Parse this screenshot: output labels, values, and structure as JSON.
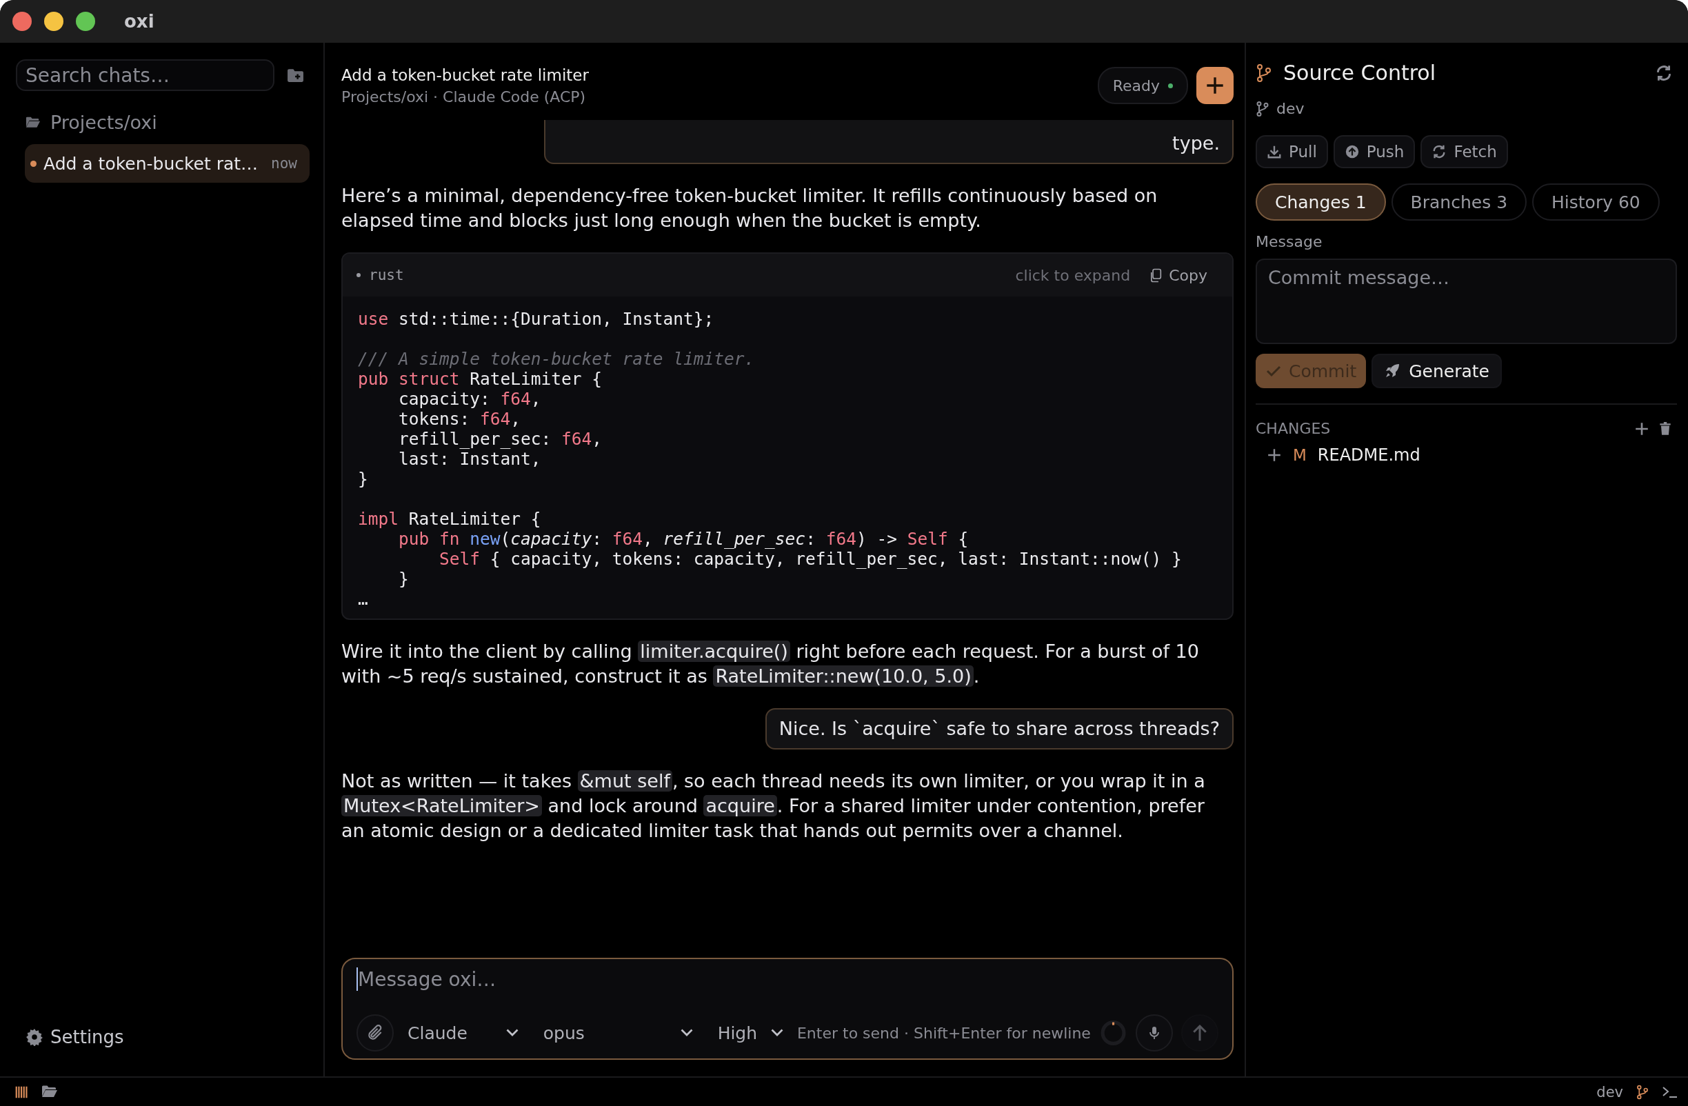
{
  "window": {
    "title": "oxi"
  },
  "sidebar": {
    "search": {
      "placeholder": "Search chats…"
    },
    "groups": [
      {
        "label": "Projects/oxi",
        "chats": [
          {
            "title": "Add a token-bucket rat…",
            "time": "now",
            "selected": true,
            "unread": true
          }
        ]
      }
    ],
    "settings": "Settings"
  },
  "chat": {
    "title": "Add a token-bucket rate limiter",
    "subtitle": "Projects/oxi · Claude Code (ACP)",
    "status": {
      "label": "Ready",
      "online": true
    },
    "messages": [
      {
        "kind": "user",
        "clipped": true,
        "text": "type."
      },
      {
        "kind": "text",
        "segments": [
          {
            "t": "Here’s a minimal, dependency-free token-bucket limiter. It refills continuously based on elapsed time and blocks just long enough when the bucket is empty.",
            "code": false
          }
        ]
      },
      {
        "kind": "code",
        "language": "rust",
        "expand_hint": "click to expand",
        "copy": "Copy",
        "lines": [
          {
            "kind": "code",
            "tokens": [
              {
                "t": "use",
                "kind": "keyword"
              },
              {
                "t": " std::time::{Duration, Instant};",
                "kind": "plain"
              }
            ]
          },
          {
            "kind": "blank"
          },
          {
            "kind": "code",
            "tokens": [
              {
                "t": "/// A simple token-bucket rate limiter.",
                "kind": "comment"
              }
            ]
          },
          {
            "kind": "code",
            "tokens": [
              {
                "t": "pub struct",
                "kind": "keyword"
              },
              {
                "t": " RateLimiter {",
                "kind": "plain"
              }
            ]
          },
          {
            "kind": "code",
            "tokens": [
              {
                "t": "    capacity: ",
                "kind": "plain"
              },
              {
                "t": "f64",
                "kind": "keyword"
              },
              {
                "t": ",",
                "kind": "plain"
              }
            ]
          },
          {
            "kind": "code",
            "tokens": [
              {
                "t": "    tokens: ",
                "kind": "plain"
              },
              {
                "t": "f64",
                "kind": "keyword"
              },
              {
                "t": ",",
                "kind": "plain"
              }
            ]
          },
          {
            "kind": "code",
            "tokens": [
              {
                "t": "    refill_per_sec: ",
                "kind": "plain"
              },
              {
                "t": "f64",
                "kind": "keyword"
              },
              {
                "t": ",",
                "kind": "plain"
              }
            ]
          },
          {
            "kind": "code",
            "tokens": [
              {
                "t": "    last: Instant,",
                "kind": "plain"
              }
            ]
          },
          {
            "kind": "code",
            "tokens": [
              {
                "t": "}",
                "kind": "plain"
              }
            ]
          },
          {
            "kind": "blank"
          },
          {
            "kind": "code",
            "tokens": [
              {
                "t": "impl",
                "kind": "keyword"
              },
              {
                "t": " RateLimiter {",
                "kind": "plain"
              }
            ]
          },
          {
            "kind": "code",
            "tokens": [
              {
                "t": "    pub fn",
                "kind": "keyword"
              },
              {
                "t": " new",
                "kind": "function"
              },
              {
                "t": "(",
                "kind": "plain"
              },
              {
                "t": "capacity",
                "kind": "parameter"
              },
              {
                "t": ": ",
                "kind": "plain"
              },
              {
                "t": "f64",
                "kind": "keyword"
              },
              {
                "t": ", ",
                "kind": "plain"
              },
              {
                "t": "refill_per_sec",
                "kind": "parameter"
              },
              {
                "t": ": ",
                "kind": "plain"
              },
              {
                "t": "f64",
                "kind": "keyword"
              },
              {
                "t": ") -> ",
                "kind": "plain"
              },
              {
                "t": "Self",
                "kind": "keyword"
              },
              {
                "t": " {",
                "kind": "plain"
              }
            ]
          },
          {
            "kind": "code",
            "tokens": [
              {
                "t": "        Self",
                "kind": "keyword"
              },
              {
                "t": " { capacity, tokens: capacity, refill_per_sec, last: Instant::now() }",
                "kind": "plain"
              }
            ]
          },
          {
            "kind": "code",
            "tokens": [
              {
                "t": "    }",
                "kind": "plain"
              }
            ]
          },
          {
            "kind": "code",
            "tokens": [
              {
                "t": "…",
                "kind": "plain"
              }
            ]
          }
        ]
      },
      {
        "kind": "text",
        "segments": [
          {
            "t": "Wire it into the client by calling ",
            "code": false
          },
          {
            "t": "limiter.acquire()",
            "code": true
          },
          {
            "t": " right before each request. For a burst of 10 with ~5 req/s sustained, construct it as ",
            "code": false
          },
          {
            "t": "RateLimiter::new(10.0, 5.0)",
            "code": true
          },
          {
            "t": ".",
            "code": false
          }
        ]
      },
      {
        "kind": "user",
        "clipped": false,
        "text": "Nice. Is `acquire` safe to share across threads?"
      },
      {
        "kind": "text",
        "segments": [
          {
            "t": "Not as written — it takes ",
            "code": false
          },
          {
            "t": "&mut self",
            "code": true
          },
          {
            "t": ", so each thread needs its own limiter, or you wrap it in a ",
            "code": false
          },
          {
            "t": "Mutex<RateLimiter>",
            "code": true
          },
          {
            "t": " and lock around ",
            "code": false
          },
          {
            "t": "acquire",
            "code": true
          },
          {
            "t": ". For a shared limiter under contention, prefer an atomic design or a dedicated limiter task that hands out permits over a channel.",
            "code": false
          }
        ]
      }
    ],
    "composer": {
      "placeholder": "Message oxi…",
      "agent": "Claude",
      "model": "opus",
      "effort": "High",
      "hint": "Enter to send · Shift+Enter for newline"
    }
  },
  "source_control": {
    "title": "Source Control",
    "branch": "dev",
    "actions": [
      "Pull",
      "Push",
      "Fetch"
    ],
    "tabs": [
      {
        "label": "Changes 1",
        "selected": true
      },
      {
        "label": "Branches 3",
        "selected": false
      },
      {
        "label": "History 60",
        "selected": false
      }
    ],
    "message_label": "Message",
    "message_placeholder": "Commit message…",
    "commit": {
      "label": "Commit",
      "disabled": true
    },
    "generate": "Generate",
    "changes_heading": "CHANGES",
    "files": [
      {
        "status": "M",
        "name": "README.md"
      }
    ]
  },
  "status_bar": {
    "branch": "dev"
  }
}
